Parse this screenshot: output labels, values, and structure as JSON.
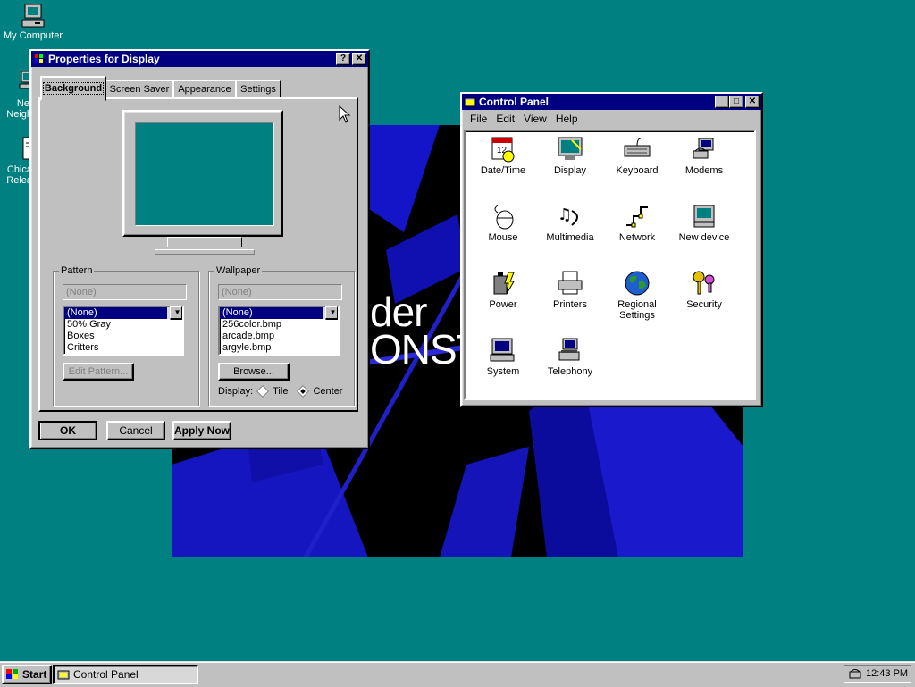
{
  "desktop": {
    "icons": [
      {
        "label": "My Computer"
      },
      {
        "label": "Net\nNeigh"
      },
      {
        "label": "Chica\nRelea"
      }
    ],
    "wallpaper_text": "der\nONST"
  },
  "display_props": {
    "title": "Properties for Display",
    "help_btn": "?",
    "close_btn": "✕",
    "tabs": [
      "Background",
      "Screen Saver",
      "Appearance",
      "Settings"
    ],
    "active_tab": "Background",
    "pattern": {
      "legend": "Pattern",
      "field_value": "(None)",
      "items": [
        "(None)",
        "50% Gray",
        "Boxes",
        "Critters"
      ],
      "selected": "(None)",
      "edit_button": "Edit Pattern..."
    },
    "wallpaper": {
      "legend": "Wallpaper",
      "field_value": "(None)",
      "items": [
        "(None)",
        "256color.bmp",
        "arcade.bmp",
        "argyle.bmp"
      ],
      "selected": "(None)",
      "browse_button": "Browse...",
      "display_label": "Display:",
      "tile_label": "Tile",
      "center_label": "Center",
      "display_mode": "Center"
    },
    "buttons": {
      "ok": "OK",
      "cancel": "Cancel",
      "apply": "Apply Now"
    }
  },
  "control_panel": {
    "title": "Control Panel",
    "menu": [
      "File",
      "Edit",
      "View",
      "Help"
    ],
    "items": [
      {
        "label": "Date/Time",
        "icon": "calendar-clock-icon"
      },
      {
        "label": "Display",
        "icon": "display-monitor-icon"
      },
      {
        "label": "Keyboard",
        "icon": "keyboard-icon"
      },
      {
        "label": "Modems",
        "icon": "modem-icon"
      },
      {
        "label": "Mouse",
        "icon": "mouse-icon"
      },
      {
        "label": "Multimedia",
        "icon": "multimedia-icon"
      },
      {
        "label": "Network",
        "icon": "network-icon"
      },
      {
        "label": "New device",
        "icon": "new-device-icon"
      },
      {
        "label": "Power",
        "icon": "power-icon"
      },
      {
        "label": "Printers",
        "icon": "printer-icon"
      },
      {
        "label": "Regional\nSettings",
        "icon": "globe-icon"
      },
      {
        "label": "Security",
        "icon": "keys-icon"
      },
      {
        "label": "System",
        "icon": "system-computer-icon"
      },
      {
        "label": "Telephony",
        "icon": "telephony-icon"
      }
    ]
  },
  "taskbar": {
    "start_label": "Start",
    "task_label": "Control Panel",
    "clock": "12:43 PM"
  }
}
